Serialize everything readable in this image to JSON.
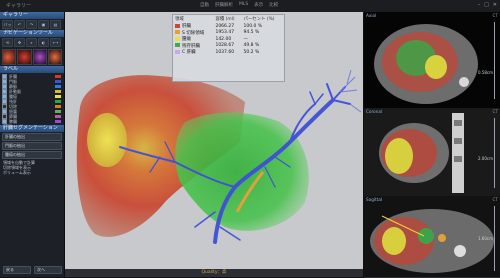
{
  "app": {
    "title": "ギャラリー",
    "tabs": [
      "自動",
      "肝臓解析",
      "MLS",
      "表示",
      "比較"
    ],
    "window_controls": [
      "–",
      "□",
      "✕"
    ]
  },
  "left_panel": {
    "header_1": "ギャラリー",
    "header_2": "バック",
    "header_3": "ナビゲーションツール",
    "header_4": "ラベル",
    "label_items": [
      {
        "name": "肝臓",
        "checked": true,
        "color": "#d13c2a"
      },
      {
        "name": "門脈",
        "checked": true,
        "color": "#3a56d6"
      },
      {
        "name": "静脈",
        "checked": true,
        "color": "#2e7de0"
      },
      {
        "name": "肝動脈",
        "checked": true,
        "color": "#d8b83c"
      },
      {
        "name": "腫瘍",
        "checked": true,
        "color": "#e9e04a"
      },
      {
        "name": "残肝",
        "checked": true,
        "color": "#2ba83b"
      },
      {
        "name": "切除",
        "checked": false,
        "color": "#e07a20"
      },
      {
        "name": "胆嚢",
        "checked": true,
        "color": "#5bb25b"
      },
      {
        "name": "膵臓",
        "checked": false,
        "color": "#c05aa0"
      },
      {
        "name": "脾臓",
        "checked": true,
        "color": "#9b4bd0"
      }
    ],
    "seg_header": "肝臓セグメンテーション",
    "seg_buttons": [
      "肝臓の抽出",
      "門脈の抽出",
      "腫瘍の抽出"
    ],
    "seg_options": [
      "領域を自動で計算",
      "切除領域を表示"
    ],
    "volume_label": "ボリューム表示",
    "bottom_buttons": [
      "戻る",
      "次へ"
    ]
  },
  "legend": {
    "headers": [
      "領域",
      "容積 (ml)",
      "パーセント (%)"
    ],
    "rows": [
      {
        "label": "肝臓",
        "volume": "2066.27",
        "percent": "100.0 %",
        "color": "#c44a3a"
      },
      {
        "label": "S 切除領域",
        "volume": "1953.47",
        "percent": "94.5 %",
        "color": "#e5a030"
      },
      {
        "label": "腫瘍",
        "volume": "142.00",
        "percent": "—",
        "color": "#e8e247"
      },
      {
        "label": "残存肝臓",
        "volume": "1028.67",
        "percent": "49.8 %",
        "color": "#45a84a"
      },
      {
        "label": "C 肝臓",
        "volume": "1037.60",
        "percent": "50.2 %",
        "color": "#c9a7e8"
      }
    ]
  },
  "main_view": {
    "bottom_label": "Quality：高"
  },
  "right_panels": [
    {
      "name": "Axial",
      "right_label": "0.58cm",
      "mode": "CT"
    },
    {
      "name": "Coronal",
      "right_label": "2.00cm",
      "mode": "CT"
    },
    {
      "name": "Sagittal",
      "right_label": "1.60cm",
      "mode": "CT"
    }
  ],
  "colors": {
    "accent": "#3f6aa3",
    "liver": "#c44a3a",
    "remnant": "#45a84a",
    "tumor": "#e8e247",
    "portal_vein": "#3f4fd8"
  }
}
